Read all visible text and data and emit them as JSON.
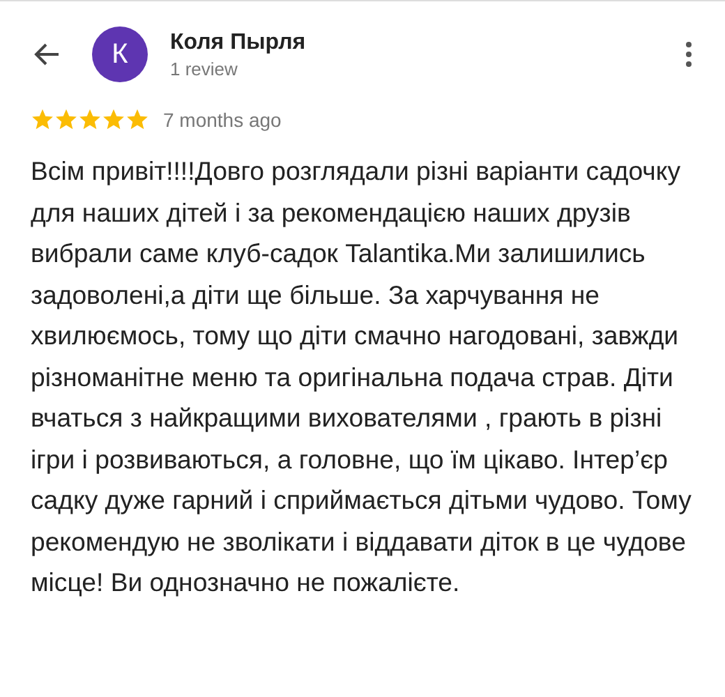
{
  "reviewer": {
    "initial": "К",
    "name": "Коля Пырля",
    "reviews": "1 review"
  },
  "review": {
    "stars": 5,
    "time": "7 months ago",
    "text": "Всім привіт!!!!Довго розглядали різні варіанти садочку для наших дітей і за рекомендацією наших друзів вибрали саме клуб-садок Talantika.Ми залишились задоволені,а діти ще більше. За харчування не хвилюємось, тому що діти смачно нагодовані, завжди різноманітне меню та оригінальна подача страв. Діти вчаться з найкращими вихователями , грають в різні ігри і розвиваються, а головне, що їм цікаво. Інтер’єр садку дуже гарний і сприймається дітьми чудово. Тому рекомендую не зволікати і віддавати діток в це чудове місце! Ви однозначно не пожалієте."
  }
}
